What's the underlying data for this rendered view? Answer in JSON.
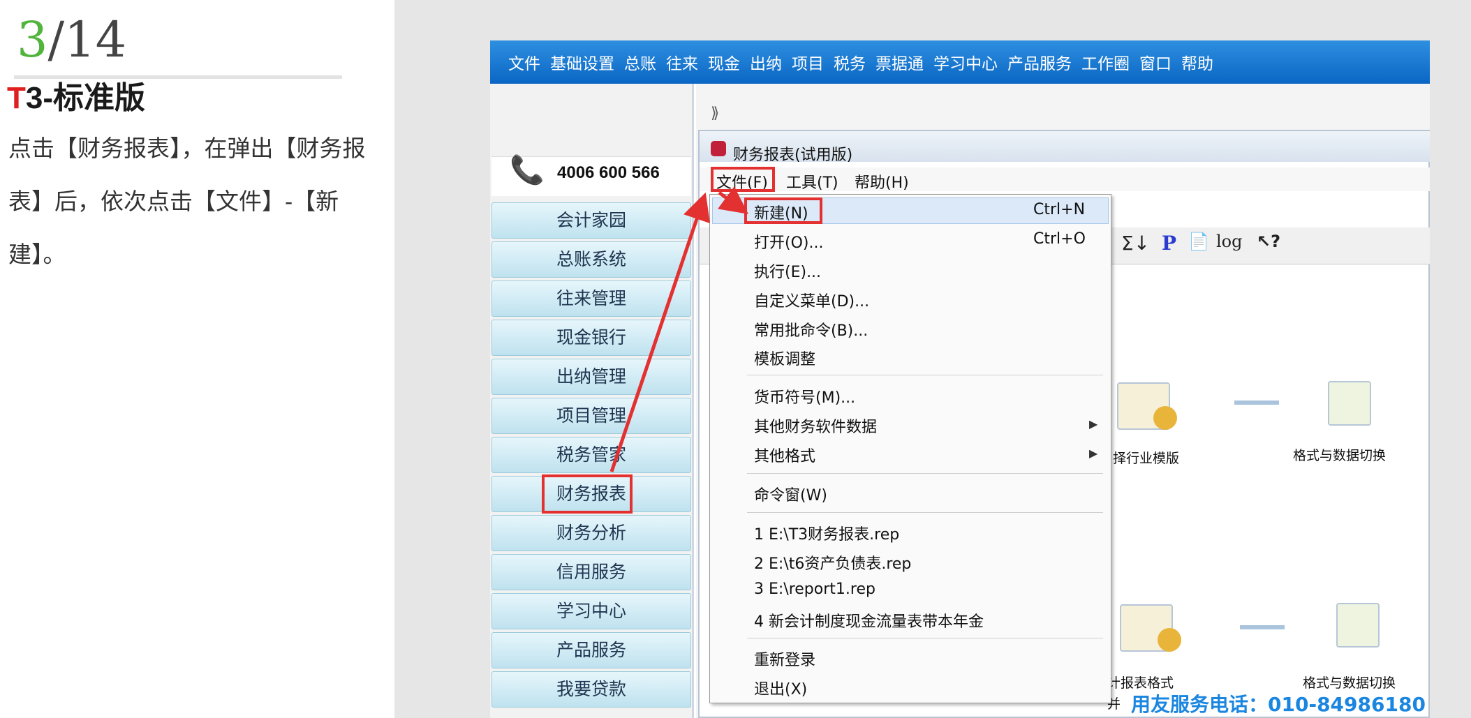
{
  "step": {
    "current": "3",
    "total": "/14"
  },
  "instructions": "点击【财务报表】，在弹出【财务报表】后，依次点击【文件】-【新建】。",
  "app_menu": [
    "文件",
    "基础设置",
    "总账",
    "往来",
    "现金",
    "出纳",
    "项目",
    "税务",
    "票据通",
    "学习中心",
    "产品服务",
    "工作圈",
    "窗口",
    "帮助"
  ],
  "brand": {
    "prefix": "T",
    "rest": "3-标准版"
  },
  "phone": "4006 600 566",
  "sidebar_items": [
    "会计家园",
    "总账系统",
    "往来管理",
    "现金银行",
    "出纳管理",
    "项目管理",
    "税务管家",
    "财务报表",
    "财务分析",
    "信用服务",
    "学习中心",
    "产品服务",
    "我要贷款"
  ],
  "window": {
    "title": "财务报表(试用版)",
    "menu": [
      "文件(F)",
      "工具(T)",
      "帮助(H)"
    ]
  },
  "file_menu": [
    {
      "label": "新建(N)",
      "shortcut": "Ctrl+N"
    },
    {
      "label": "打开(O)...",
      "shortcut": "Ctrl+O"
    },
    {
      "label": "执行(E)..."
    },
    {
      "label": "自定义菜单(D)..."
    },
    {
      "label": "常用批命令(B)..."
    },
    {
      "label": "模板调整"
    },
    {
      "label": "货币符号(M)..."
    },
    {
      "label": "其他财务软件数据",
      "submenu": true
    },
    {
      "label": "其他格式",
      "submenu": true
    },
    {
      "label": "命令窗(W)"
    },
    {
      "label": "1 E:\\T3财务报表.rep"
    },
    {
      "label": "2 E:\\t6资产负债表.rep"
    },
    {
      "label": "3 E:\\report1.rep"
    },
    {
      "label": "4 新会计制度现金流量表带本年金"
    },
    {
      "label": "重新登录"
    },
    {
      "label": "退出(X)"
    }
  ],
  "toolbar_glyphs": [
    "Σ↓",
    "P",
    "📄",
    "log",
    "↖?"
  ],
  "flow_labels": [
    "择行业模版",
    "格式与数据切换",
    "计报表格式",
    "格式与数据切换",
    "并"
  ],
  "watermark": "用友服务电话：010-84986180",
  "colors": {
    "accent": "#52b43c",
    "menubar": "#0a66c4",
    "highlight": "#e33030"
  }
}
